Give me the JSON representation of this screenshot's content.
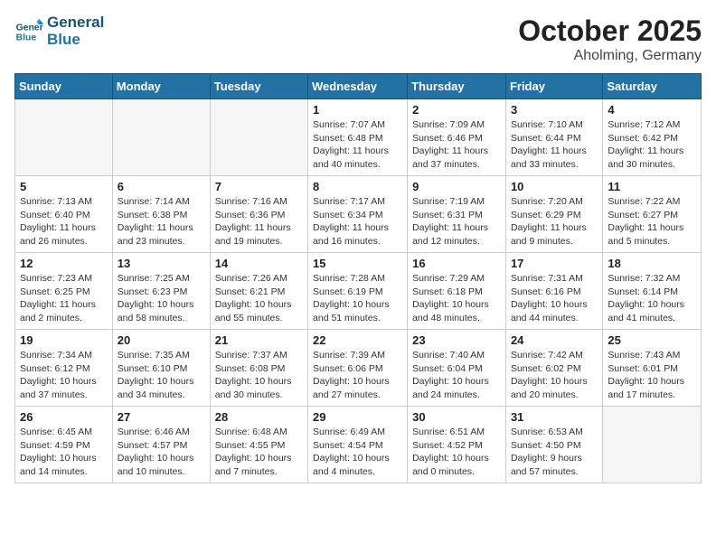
{
  "header": {
    "logo_line1": "General",
    "logo_line2": "Blue",
    "month": "October 2025",
    "location": "Aholming, Germany"
  },
  "weekdays": [
    "Sunday",
    "Monday",
    "Tuesday",
    "Wednesday",
    "Thursday",
    "Friday",
    "Saturday"
  ],
  "weeks": [
    [
      {
        "day": "",
        "info": ""
      },
      {
        "day": "",
        "info": ""
      },
      {
        "day": "",
        "info": ""
      },
      {
        "day": "1",
        "info": "Sunrise: 7:07 AM\nSunset: 6:48 PM\nDaylight: 11 hours\nand 40 minutes."
      },
      {
        "day": "2",
        "info": "Sunrise: 7:09 AM\nSunset: 6:46 PM\nDaylight: 11 hours\nand 37 minutes."
      },
      {
        "day": "3",
        "info": "Sunrise: 7:10 AM\nSunset: 6:44 PM\nDaylight: 11 hours\nand 33 minutes."
      },
      {
        "day": "4",
        "info": "Sunrise: 7:12 AM\nSunset: 6:42 PM\nDaylight: 11 hours\nand 30 minutes."
      }
    ],
    [
      {
        "day": "5",
        "info": "Sunrise: 7:13 AM\nSunset: 6:40 PM\nDaylight: 11 hours\nand 26 minutes."
      },
      {
        "day": "6",
        "info": "Sunrise: 7:14 AM\nSunset: 6:38 PM\nDaylight: 11 hours\nand 23 minutes."
      },
      {
        "day": "7",
        "info": "Sunrise: 7:16 AM\nSunset: 6:36 PM\nDaylight: 11 hours\nand 19 minutes."
      },
      {
        "day": "8",
        "info": "Sunrise: 7:17 AM\nSunset: 6:34 PM\nDaylight: 11 hours\nand 16 minutes."
      },
      {
        "day": "9",
        "info": "Sunrise: 7:19 AM\nSunset: 6:31 PM\nDaylight: 11 hours\nand 12 minutes."
      },
      {
        "day": "10",
        "info": "Sunrise: 7:20 AM\nSunset: 6:29 PM\nDaylight: 11 hours\nand 9 minutes."
      },
      {
        "day": "11",
        "info": "Sunrise: 7:22 AM\nSunset: 6:27 PM\nDaylight: 11 hours\nand 5 minutes."
      }
    ],
    [
      {
        "day": "12",
        "info": "Sunrise: 7:23 AM\nSunset: 6:25 PM\nDaylight: 11 hours\nand 2 minutes."
      },
      {
        "day": "13",
        "info": "Sunrise: 7:25 AM\nSunset: 6:23 PM\nDaylight: 10 hours\nand 58 minutes."
      },
      {
        "day": "14",
        "info": "Sunrise: 7:26 AM\nSunset: 6:21 PM\nDaylight: 10 hours\nand 55 minutes."
      },
      {
        "day": "15",
        "info": "Sunrise: 7:28 AM\nSunset: 6:19 PM\nDaylight: 10 hours\nand 51 minutes."
      },
      {
        "day": "16",
        "info": "Sunrise: 7:29 AM\nSunset: 6:18 PM\nDaylight: 10 hours\nand 48 minutes."
      },
      {
        "day": "17",
        "info": "Sunrise: 7:31 AM\nSunset: 6:16 PM\nDaylight: 10 hours\nand 44 minutes."
      },
      {
        "day": "18",
        "info": "Sunrise: 7:32 AM\nSunset: 6:14 PM\nDaylight: 10 hours\nand 41 minutes."
      }
    ],
    [
      {
        "day": "19",
        "info": "Sunrise: 7:34 AM\nSunset: 6:12 PM\nDaylight: 10 hours\nand 37 minutes."
      },
      {
        "day": "20",
        "info": "Sunrise: 7:35 AM\nSunset: 6:10 PM\nDaylight: 10 hours\nand 34 minutes."
      },
      {
        "day": "21",
        "info": "Sunrise: 7:37 AM\nSunset: 6:08 PM\nDaylight: 10 hours\nand 30 minutes."
      },
      {
        "day": "22",
        "info": "Sunrise: 7:39 AM\nSunset: 6:06 PM\nDaylight: 10 hours\nand 27 minutes."
      },
      {
        "day": "23",
        "info": "Sunrise: 7:40 AM\nSunset: 6:04 PM\nDaylight: 10 hours\nand 24 minutes."
      },
      {
        "day": "24",
        "info": "Sunrise: 7:42 AM\nSunset: 6:02 PM\nDaylight: 10 hours\nand 20 minutes."
      },
      {
        "day": "25",
        "info": "Sunrise: 7:43 AM\nSunset: 6:01 PM\nDaylight: 10 hours\nand 17 minutes."
      }
    ],
    [
      {
        "day": "26",
        "info": "Sunrise: 6:45 AM\nSunset: 4:59 PM\nDaylight: 10 hours\nand 14 minutes."
      },
      {
        "day": "27",
        "info": "Sunrise: 6:46 AM\nSunset: 4:57 PM\nDaylight: 10 hours\nand 10 minutes."
      },
      {
        "day": "28",
        "info": "Sunrise: 6:48 AM\nSunset: 4:55 PM\nDaylight: 10 hours\nand 7 minutes."
      },
      {
        "day": "29",
        "info": "Sunrise: 6:49 AM\nSunset: 4:54 PM\nDaylight: 10 hours\nand 4 minutes."
      },
      {
        "day": "30",
        "info": "Sunrise: 6:51 AM\nSunset: 4:52 PM\nDaylight: 10 hours\nand 0 minutes."
      },
      {
        "day": "31",
        "info": "Sunrise: 6:53 AM\nSunset: 4:50 PM\nDaylight: 9 hours\nand 57 minutes."
      },
      {
        "day": "",
        "info": ""
      }
    ]
  ]
}
